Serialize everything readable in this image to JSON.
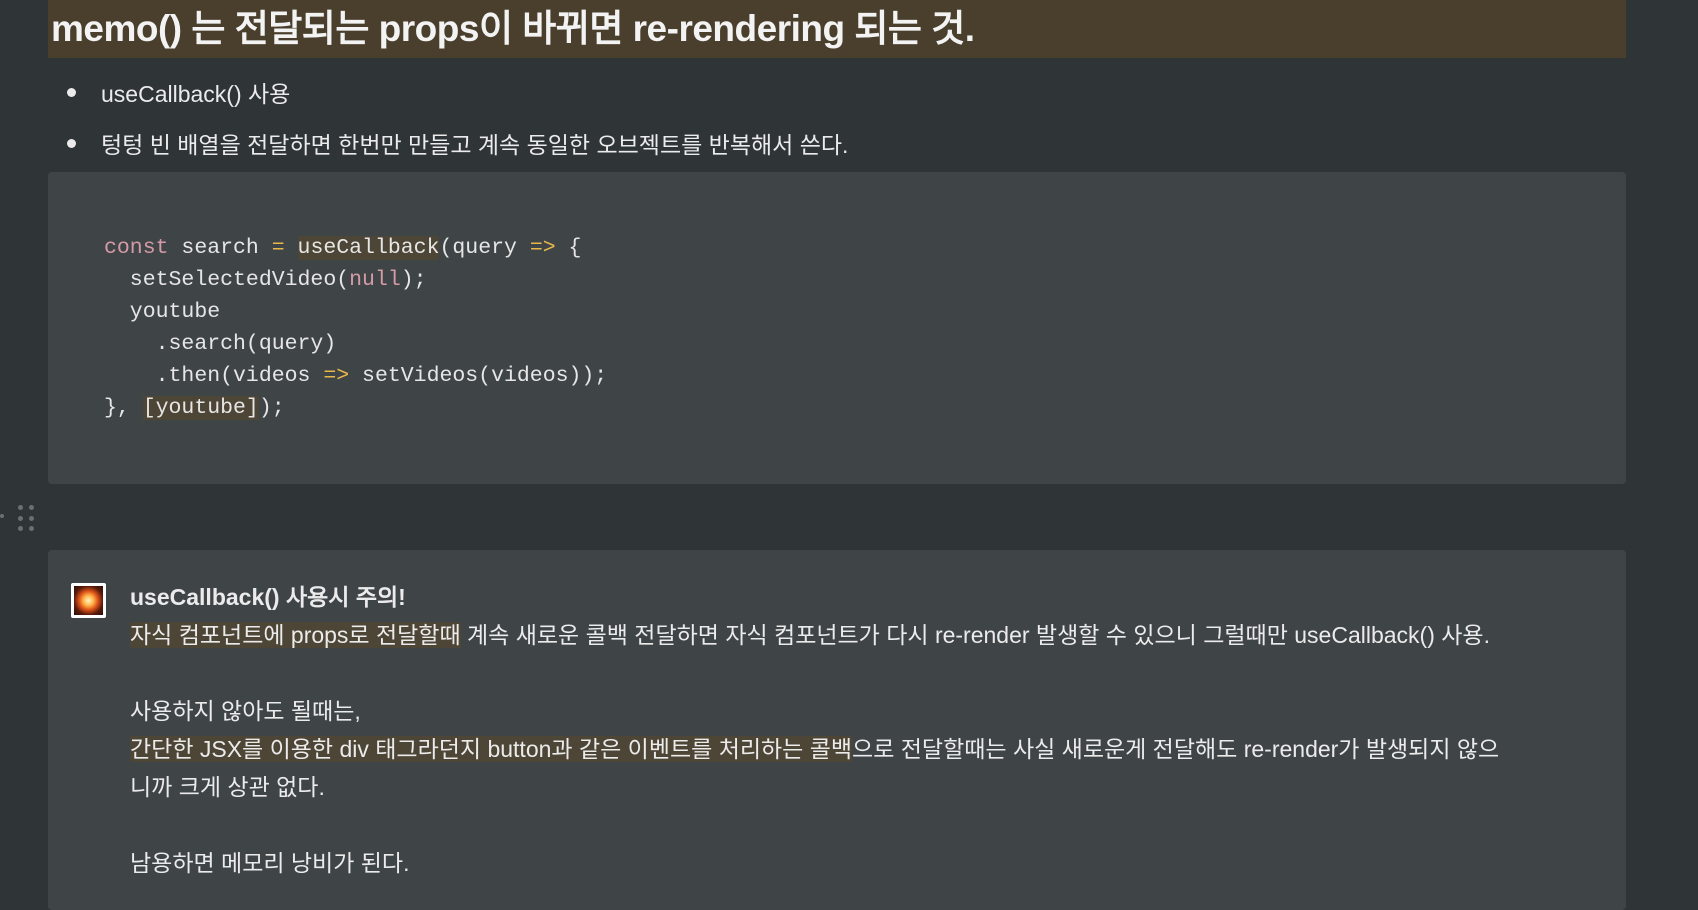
{
  "heading": "memo() 는 전달되는 props이 바뀌면 re-rendering 되는 것.",
  "bullets": [
    "useCallback() 사용",
    "텅텅 빈 배열을 전달하면 한번만 만들고 계속 동일한 오브젝트를 반복해서 쓴다."
  ],
  "code": {
    "l1_kw": "const",
    "l1_a": " search ",
    "l1_eq": "=",
    "l1_b": " ",
    "l1_fn": "useCallback",
    "l1_c": "(query ",
    "l1_arrow": "=>",
    "l1_d": " {",
    "l2_a": "  setSelectedVideo(",
    "l2_null": "null",
    "l2_b": ");",
    "l3": "  youtube",
    "l4": "    .search(query)",
    "l5_a": "    .then(videos ",
    "l5_arrow": "=>",
    "l5_b": " setVideos(videos));",
    "l6_a": "}, ",
    "l6_dep": "[youtube]",
    "l6_b": ");"
  },
  "callout": {
    "icon": "burst-icon",
    "title": "useCallback() 사용시 주의!",
    "p1_hl": "자식 컴포넌트에 props로 전달할때",
    "p1_rest": " 계속 새로운 콜백 전달하면 자식 컴포넌트가 다시 re-render 발생할 수 있으니 그럴때만 useCallback() 사용.",
    "p2": "사용하지 않아도 될때는,",
    "p3_hl": "간단한 JSX를 이용한 div 태그라던지 button과 같은 이벤트를 처리하는 콜백",
    "p3_rest": "으로 전달할때는 사실 새로운게 전달해도 re-render가 발생되지 않으",
    "p3_cont": "니까 크게 상관 없다.",
    "p4": "남용하면 메모리 낭비가 된다."
  },
  "colors": {
    "background": "#2f3437",
    "heading_bg": "#4a3f2c",
    "block_bg": "#3f4447",
    "highlight": "#4d4535",
    "keyword": "#d49aa6",
    "operator": "#e9b84a"
  }
}
